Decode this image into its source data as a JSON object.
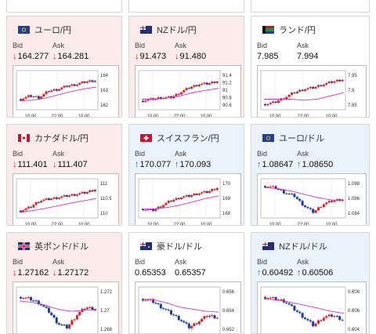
{
  "labels": {
    "bid": "Bid",
    "ask": "Ask"
  },
  "colors": {
    "up": "#1a6fd6",
    "down": "#e02020",
    "ma": "#cc33cc",
    "bull_candle": "#e02020",
    "bear_candle": "#1a3a9c"
  },
  "cards": [
    {
      "name": "eurjpy",
      "title": "ユーロ/円",
      "flag_icon": "eu-flag-icon",
      "bid": "164.277",
      "ask": "164.281",
      "dir": "down",
      "arrow": "↓",
      "y_ticks": [
        "164",
        "163",
        "162"
      ],
      "x_ticks": [
        "10:00",
        "22:00",
        "10:00"
      ]
    },
    {
      "name": "nzdjpy",
      "title": "NZドル/円",
      "flag_icon": "nz-flag-icon",
      "bid": "91.473",
      "ask": "91.480",
      "dir": "down",
      "arrow": "↓",
      "y_ticks": [
        "91.4",
        "91.2",
        "91",
        "90.8",
        "90.6"
      ],
      "x_ticks": [
        "10:00",
        "22:00",
        "10:00"
      ]
    },
    {
      "name": "zarjpy",
      "title": "ランド/円",
      "flag_icon": "za-flag-icon",
      "bid": "7.985",
      "ask": "7.994",
      "dir": "none",
      "arrow": "",
      "y_ticks": [
        "7.95",
        "7.9",
        "7.85"
      ],
      "x_ticks": [
        "10:00",
        "22:00",
        "10:00"
      ]
    },
    {
      "name": "cadjpy",
      "title": "カナダドル/円",
      "flag_icon": "ca-flag-icon",
      "bid": "111.401",
      "ask": "111.407",
      "dir": "down",
      "arrow": "↓",
      "y_ticks": [
        "111",
        "110.5",
        "110"
      ],
      "x_ticks": [
        "10:00",
        "22:00",
        "10:00"
      ]
    },
    {
      "name": "chfjpy",
      "title": "スイスフラン/円",
      "flag_icon": "ch-flag-icon",
      "bid": "170.077",
      "ask": "170.093",
      "dir": "up",
      "arrow": "↑",
      "y_ticks": [
        "170",
        "169",
        "168"
      ],
      "x_ticks": [
        "10:00",
        "22:00",
        "10:00"
      ]
    },
    {
      "name": "eurusd",
      "title": "ユーロ/ドル",
      "flag_icon": "eu-us-flag-icon",
      "bid": "1.08647",
      "ask": "1.08650",
      "dir": "up",
      "arrow": "↑",
      "y_ticks": [
        "1.088",
        "1.086",
        "1.084"
      ],
      "x_ticks": [
        "10:00",
        "22:00",
        "10:00"
      ]
    },
    {
      "name": "gbpusd",
      "title": "英ポンド/ドル",
      "flag_icon": "gb-us-flag-icon",
      "bid": "1.27162",
      "ask": "1.27172",
      "dir": "down",
      "arrow": "↓",
      "y_ticks": [
        "1.272",
        "1.27",
        "1.268"
      ],
      "x_ticks": []
    },
    {
      "name": "audusd",
      "title": "豪ドル/ドル",
      "flag_icon": "au-us-flag-icon",
      "bid": "0.65353",
      "ask": "0.65357",
      "dir": "none",
      "arrow": "",
      "y_ticks": [
        "0.656",
        "0.654",
        "0.652"
      ],
      "x_ticks": []
    },
    {
      "name": "nzdusd",
      "title": "NZドル/ドル",
      "flag_icon": "nz-us-flag-icon",
      "bid": "0.60492",
      "ask": "0.60506",
      "dir": "up",
      "arrow": "↑",
      "y_ticks": [
        "0.608",
        "0.606",
        "0.604"
      ],
      "x_ticks": []
    }
  ]
}
